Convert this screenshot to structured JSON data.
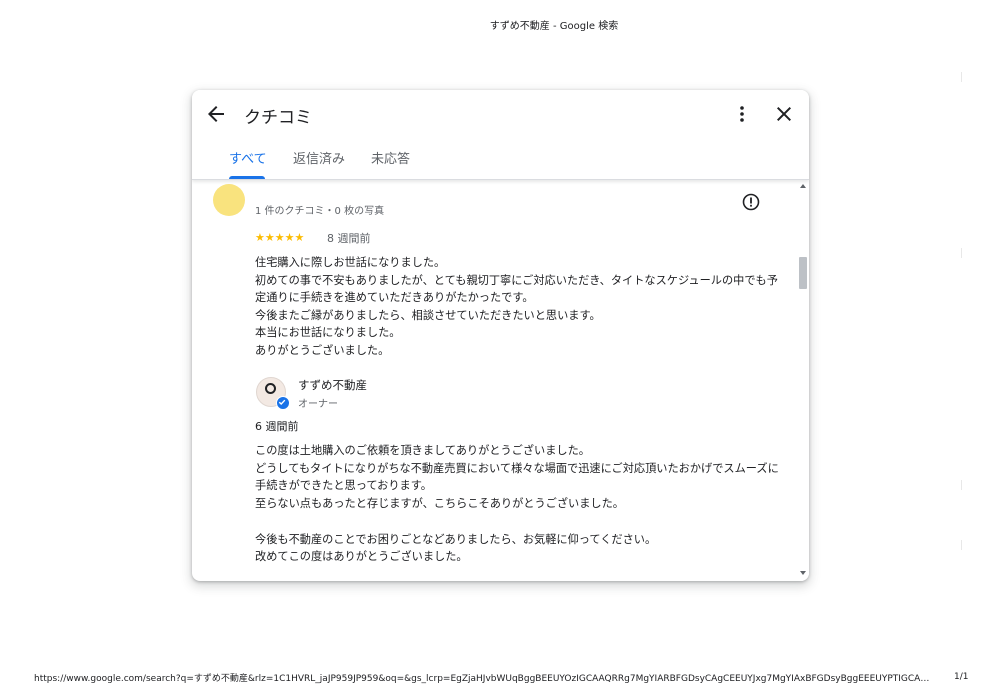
{
  "print_header": {
    "title": "すずめ不動産 - Google 検索"
  },
  "print_footer": {
    "url": "https://www.google.com/search?q=すずめ不動産&rlz=1C1HVRL_jaJP959JP959&oq=&gs_lcrp=EgZjaHJvbWUqBggBEEUYOzIGCAAQRRg7MgYIARBFGDsyCAgCEEUYJxg7MgYIAxBFGDsyBggEEEUYPTIGCAUQ...",
    "page": "1/1"
  },
  "dialog": {
    "title": "クチコミ",
    "icons": {
      "back": "arrow-back-icon",
      "more": "more-vert-icon",
      "close": "close-icon",
      "flag": "report-icon"
    },
    "tabs": [
      {
        "label": "すべて",
        "active": true
      },
      {
        "label": "返信済み",
        "active": false
      },
      {
        "label": "未応答",
        "active": false
      }
    ],
    "accent_color": "#1a73e8"
  },
  "review": {
    "meta": "1 件のクチコミ・0 枚の写真",
    "rating": 5,
    "stars": "★★★★★",
    "date": "8 週間前",
    "text": "住宅購入に際しお世話になりました。\n初めての事で不安もありましたが、とても親切丁寧にご対応いただき、タイトなスケジュールの中でも予定通りに手続きを進めていただきありがたかったです。\n今後またご縁がありましたら、相談させていただきたいと思います。\n本当にお世話になりました。\nありがとうございました。"
  },
  "owner_reply": {
    "name": "すずめ不動産",
    "role": "オーナー",
    "date": "6 週間前",
    "text": "この度は土地購入のご依頼を頂きましてありがとうございました。\nどうしてもタイトになりがちな不動産売買において様々な場面で迅速にご対応頂いたおかげでスムーズに手続きができたと思っております。\n至らない点もあったと存じますが、こちらこそありがとうございました。\n\n今後も不動産のことでお困りごとなどありましたら、お気軽に仰ってください。\n改めてこの度はありがとうございました。"
  }
}
